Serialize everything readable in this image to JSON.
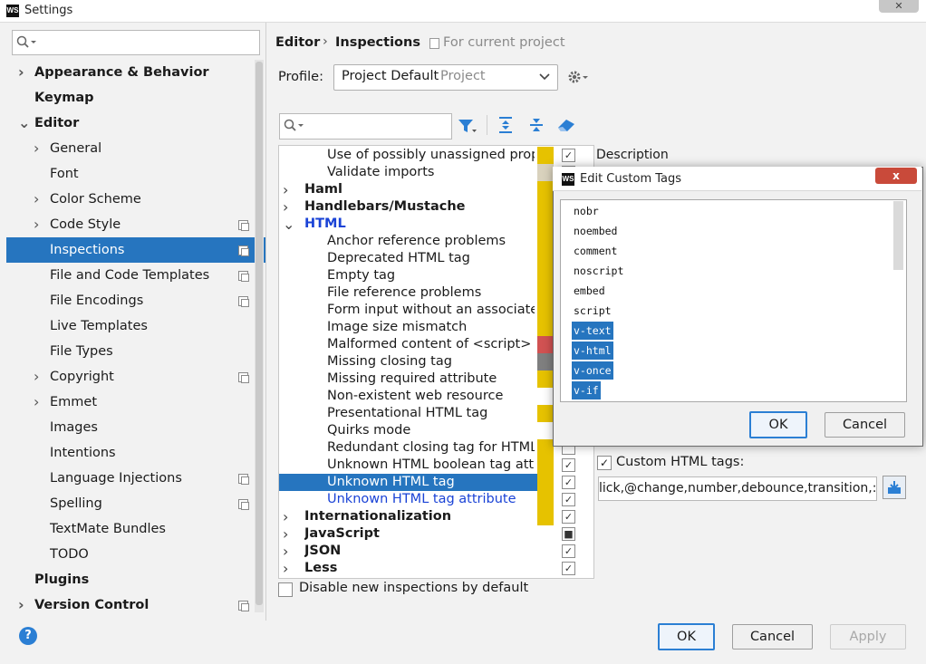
{
  "window": {
    "title": "Settings",
    "logo": "WS"
  },
  "left_tree": {
    "search_placeholder": "",
    "items": [
      {
        "label": "Appearance & Behavior",
        "bold": true,
        "arrow": "right"
      },
      {
        "label": "Keymap",
        "bold": true
      },
      {
        "label": "Editor",
        "bold": true,
        "arrow": "down"
      },
      {
        "label": "General",
        "arrow": "right"
      },
      {
        "label": "Font"
      },
      {
        "label": "Color Scheme",
        "arrow": "right"
      },
      {
        "label": "Code Style",
        "arrow": "right",
        "copy": true
      },
      {
        "label": "Inspections",
        "selected": true,
        "copy": true
      },
      {
        "label": "File and Code Templates",
        "copy": true
      },
      {
        "label": "File Encodings",
        "copy": true
      },
      {
        "label": "Live Templates"
      },
      {
        "label": "File Types"
      },
      {
        "label": "Copyright",
        "arrow": "right",
        "copy": true
      },
      {
        "label": "Emmet",
        "arrow": "right"
      },
      {
        "label": "Images"
      },
      {
        "label": "Intentions"
      },
      {
        "label": "Language Injections",
        "copy": true
      },
      {
        "label": "Spelling",
        "copy": true
      },
      {
        "label": "TextMate Bundles"
      },
      {
        "label": "TODO"
      },
      {
        "label": "Plugins",
        "bold": true
      },
      {
        "label": "Version Control",
        "bold": true,
        "arrow": "right",
        "copy": true
      }
    ]
  },
  "header": {
    "breadcrumb_editor": "Editor",
    "breadcrumb_sep": "›",
    "breadcrumb_current": "Inspections",
    "scope_note": "For current project"
  },
  "profile": {
    "label": "Profile:",
    "value": "Project Default",
    "scope": "Project"
  },
  "inspections": {
    "rows": [
      {
        "label": "Use of possibly unassigned proper",
        "indent": 2,
        "sev": "#e6c200",
        "check": "✓"
      },
      {
        "label": "Validate imports",
        "indent": 2,
        "sev": "#d9d2bd",
        "check": ""
      },
      {
        "label": "Haml",
        "indent": 1,
        "bold": true,
        "arrow": "›",
        "sev": "#e6c200",
        "check": ""
      },
      {
        "label": "Handlebars/Mustache",
        "indent": 1,
        "bold": true,
        "arrow": "›",
        "sev": "#e6c200",
        "check": ""
      },
      {
        "label": "HTML",
        "indent": 1,
        "bold": true,
        "arrow": "⌄",
        "blue": true,
        "sev": "#e6c200",
        "check": ""
      },
      {
        "label": "Anchor reference problems",
        "indent": 2,
        "sev": "#e6c200",
        "check": ""
      },
      {
        "label": "Deprecated HTML tag",
        "indent": 2,
        "sev": "#e6c200",
        "check": ""
      },
      {
        "label": "Empty tag",
        "indent": 2,
        "sev": "#e6c200",
        "check": ""
      },
      {
        "label": "File reference problems",
        "indent": 2,
        "sev": "#e6c200",
        "check": ""
      },
      {
        "label": "Form input without an associated",
        "indent": 2,
        "sev": "#e6c200",
        "check": ""
      },
      {
        "label": "Image size mismatch",
        "indent": 2,
        "sev": "#e6c200",
        "check": ""
      },
      {
        "label": "Malformed content of <script> ta",
        "indent": 2,
        "sev": "#d15252",
        "check": ""
      },
      {
        "label": "Missing closing tag",
        "indent": 2,
        "sev": "#7f7f7f",
        "check": ""
      },
      {
        "label": "Missing required attribute",
        "indent": 2,
        "sev": "#e6c200",
        "check": ""
      },
      {
        "label": "Non-existent web resource",
        "indent": 2,
        "sev": "",
        "check": ""
      },
      {
        "label": "Presentational HTML tag",
        "indent": 2,
        "sev": "#e6c200",
        "check": ""
      },
      {
        "label": "Quirks mode",
        "indent": 2,
        "sev": "",
        "check": ""
      },
      {
        "label": "Redundant closing tag for HTML e",
        "indent": 2,
        "sev": "#e6c200",
        "check": ""
      },
      {
        "label": "Unknown HTML boolean tag attri",
        "indent": 2,
        "sev": "#e6c200",
        "check": "✓"
      },
      {
        "label": "Unknown HTML tag",
        "indent": 2,
        "selected": true,
        "sev": "#e6c200",
        "check": "✓"
      },
      {
        "label": "Unknown HTML tag attribute",
        "indent": 2,
        "blue": true,
        "sev": "#e6c200",
        "check": "✓"
      },
      {
        "label": "Internationalization",
        "indent": 1,
        "bold": true,
        "arrow": "›",
        "sev": "#e6c200",
        "check": "✓"
      },
      {
        "label": "JavaScript",
        "indent": 1,
        "bold": true,
        "arrow": "›",
        "sev": "",
        "check": "■"
      },
      {
        "label": "JSON",
        "indent": 1,
        "bold": true,
        "arrow": "›",
        "sev": "",
        "check": "✓"
      },
      {
        "label": "Less",
        "indent": 1,
        "bold": true,
        "arrow": "›",
        "sev": "",
        "check": "✓"
      }
    ]
  },
  "description": {
    "label": "Description",
    "custom_tags_label": "Custom HTML tags:",
    "custom_tags_value": "lick,@change,number,debounce,transition,:is"
  },
  "disable_new": "Disable new inspections by default",
  "buttons": {
    "ok": "OK",
    "cancel": "Cancel",
    "apply": "Apply",
    "help": "?"
  },
  "dialog": {
    "logo": "WS",
    "title": "Edit Custom Tags",
    "close": "x",
    "tags": [
      {
        "text": "nobr"
      },
      {
        "text": "noembed"
      },
      {
        "text": "comment"
      },
      {
        "text": "noscript"
      },
      {
        "text": "embed"
      },
      {
        "text": "script"
      },
      {
        "text": "v-text",
        "selected": true
      },
      {
        "text": "v-html",
        "selected": true
      },
      {
        "text": "v-once",
        "selected": true
      },
      {
        "text": "v-if",
        "selected": true
      }
    ],
    "ok": "OK",
    "cancel": "Cancel"
  },
  "colors": {
    "selection": "#2675bf",
    "accent_blue": "#2b7fd4",
    "warning_yellow": "#e6c200",
    "error_red": "#d15252"
  }
}
